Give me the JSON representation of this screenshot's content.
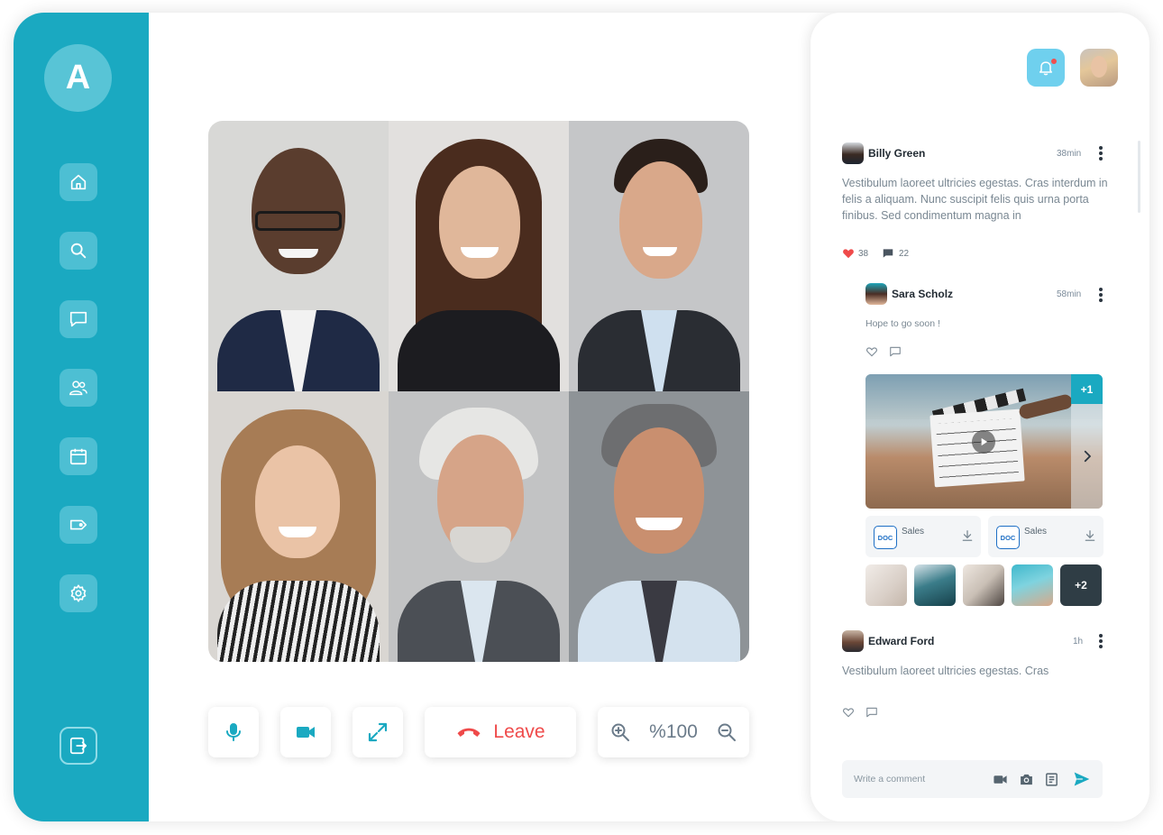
{
  "brand": {
    "letter": "A",
    "accent": "#1aa9c1"
  },
  "sidebar": {
    "items": [
      {
        "name": "home",
        "icon": "home-icon"
      },
      {
        "name": "search",
        "icon": "search-icon"
      },
      {
        "name": "messages",
        "icon": "chat-icon"
      },
      {
        "name": "contacts",
        "icon": "users-icon"
      },
      {
        "name": "calendar",
        "icon": "calendar-icon"
      },
      {
        "name": "tags",
        "icon": "tag-icon"
      },
      {
        "name": "settings",
        "icon": "gear-icon"
      }
    ],
    "logout_icon": "logout-icon"
  },
  "call": {
    "participants": 6,
    "controls": {
      "leave_label": "Leave",
      "zoom_value": "%100"
    }
  },
  "panel": {
    "notification_icon": "bell-icon",
    "has_unread": true,
    "posts": [
      {
        "author": "Billy Green",
        "time": "38min",
        "text": "Vestibulum laoreet ultricies egestas. Cras interdum in felis a aliquam. Nunc suscipit felis quis urna porta finibus. Sed condimentum magna in",
        "likes": "38",
        "comments": "22"
      },
      {
        "author": "Sara Scholz",
        "time": "58min",
        "text": "Hope to go soon !",
        "media_more": "+1",
        "docs": [
          {
            "type": "DOC",
            "name": "Sales"
          },
          {
            "type": "DOC",
            "name": "Sales"
          }
        ],
        "thumbs_more": "+2"
      },
      {
        "author": "Edward Ford",
        "time": "1h",
        "text": "Vestibulum laoreet ultricies egestas. Cras"
      }
    ],
    "comment": {
      "placeholder": "Write a comment"
    }
  }
}
